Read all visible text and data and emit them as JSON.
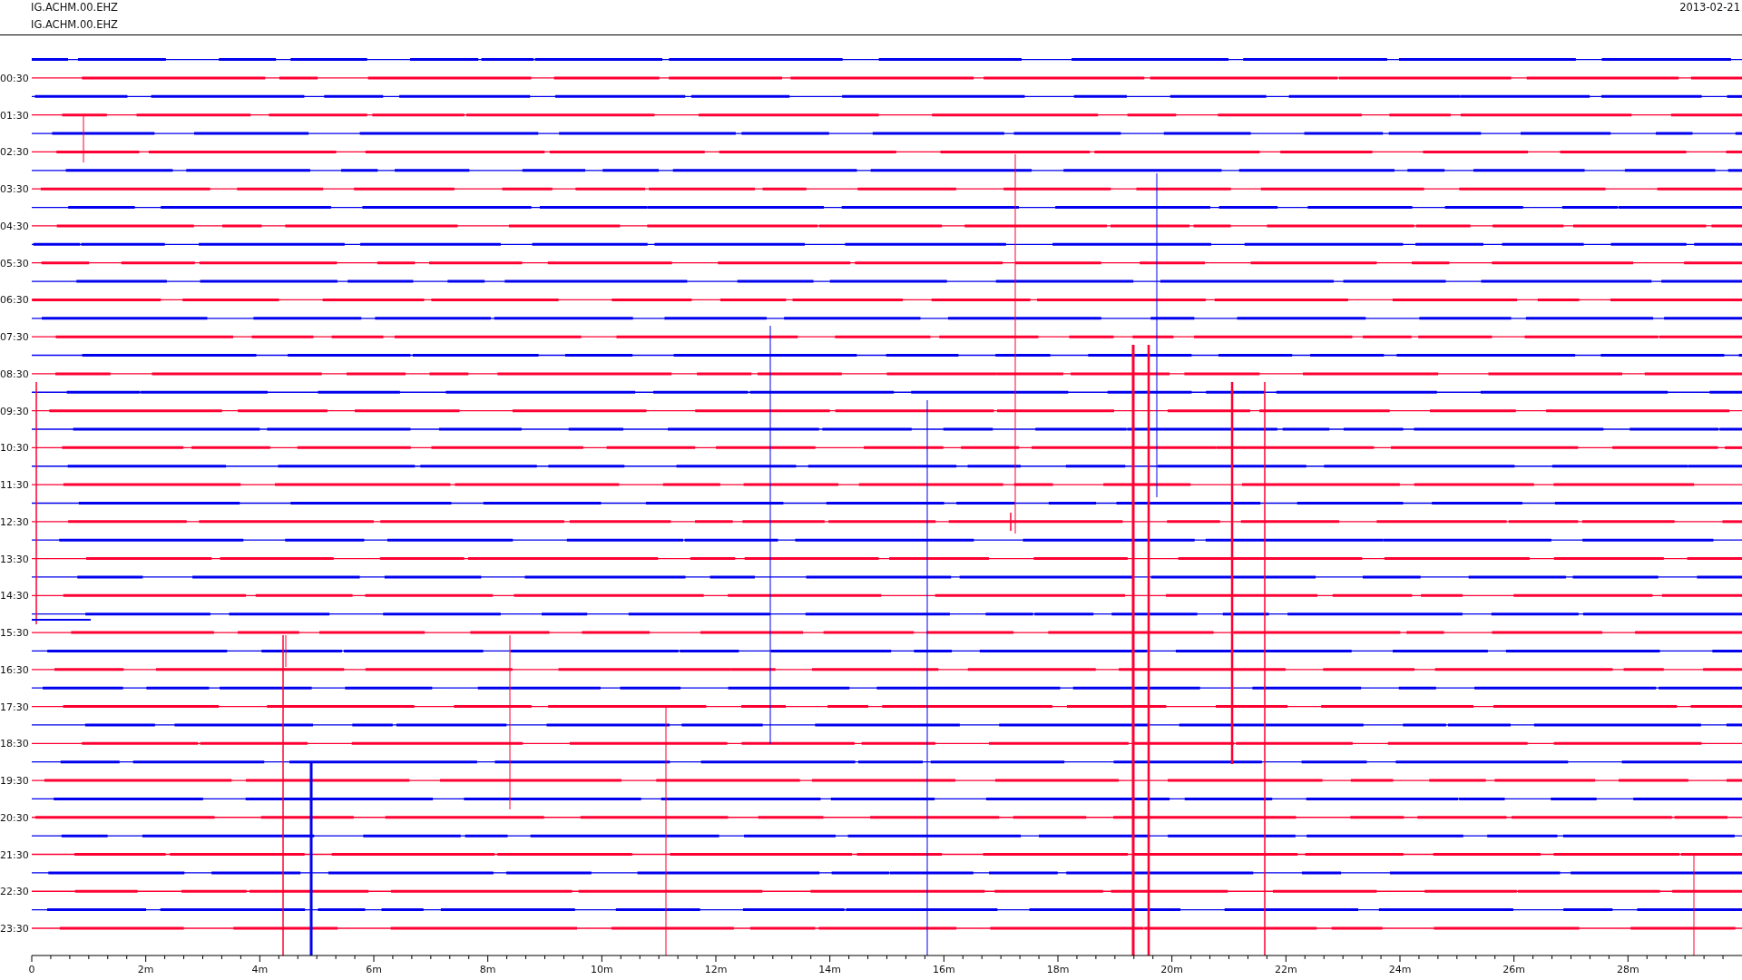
{
  "header": {
    "station_labels": [
      "IG.ACHM.00.EHZ",
      "IG.ACHM.00.EHZ"
    ],
    "date": "2013-02-21"
  },
  "plot": {
    "row_labels": [
      "00:30",
      "01:30",
      "02:30",
      "03:30",
      "04:30",
      "05:30",
      "06:30",
      "07:30",
      "08:30",
      "09:30",
      "10:30",
      "11:30",
      "12:30",
      "13:30",
      "14:30",
      "15:30",
      "16:30",
      "17:30",
      "18:30",
      "19:30",
      "20:30",
      "21:30",
      "22:30",
      "23:30"
    ],
    "x_tick_labels": [
      "0",
      "2m",
      "4m",
      "6m",
      "8m",
      "10m",
      "12m",
      "14m",
      "16m",
      "18m",
      "20m",
      "22m",
      "24m",
      "26m",
      "28m"
    ]
  }
}
